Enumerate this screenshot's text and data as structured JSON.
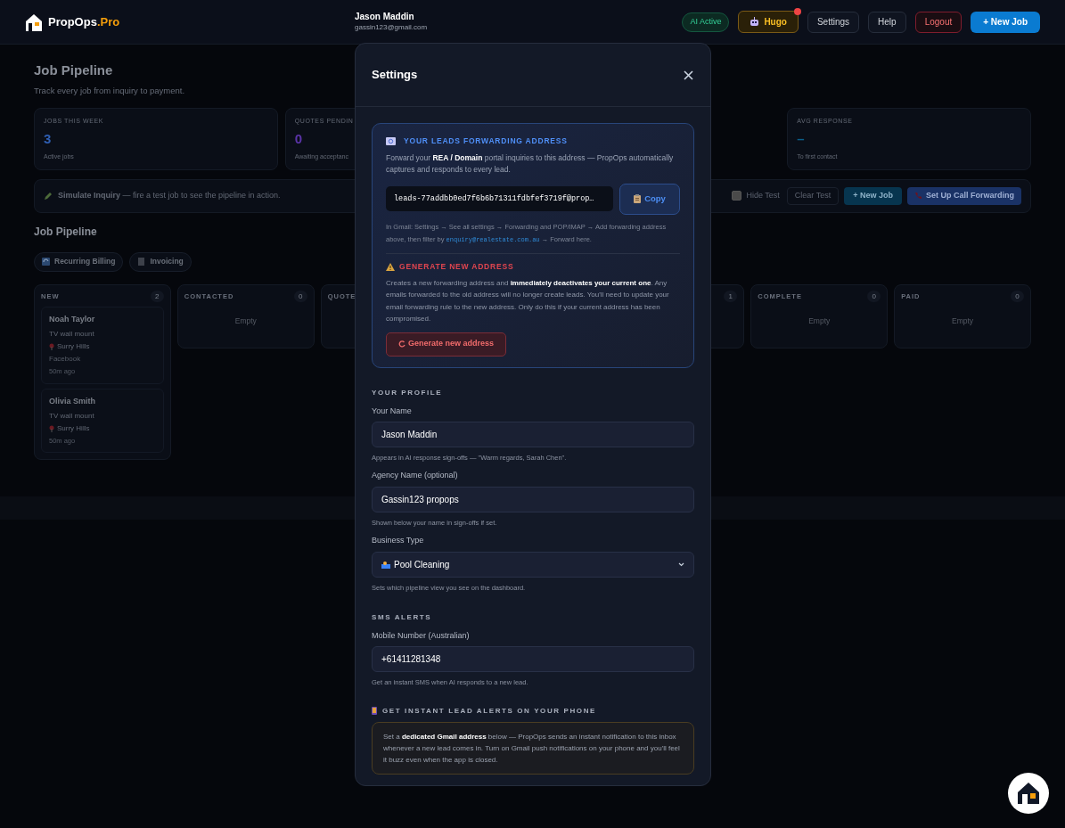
{
  "header": {
    "logo_text": "PropOps",
    "logo_suffix": ".Pro",
    "user_name": "Jason Maddin",
    "user_email": "gassin123@gmail.com",
    "status_badge": "AI Active",
    "assistant": {
      "label": "Hugo",
      "notification": true
    },
    "buttons": [
      {
        "label": "Settings",
        "kind": "plain"
      },
      {
        "label": "Help",
        "kind": "plain"
      },
      {
        "label": "Logout",
        "kind": "danger"
      },
      {
        "label": "+ New Job",
        "kind": "primary"
      }
    ]
  },
  "dashboard": {
    "title": "Job Pipeline",
    "subtitle": "Track every job from inquiry to payment.",
    "stats": [
      {
        "label": "JOBS THIS WEEK",
        "value": "3",
        "note": "Active jobs",
        "color": "#2f5fb3"
      },
      {
        "label": "QUOTES PENDIN",
        "value": "0",
        "note": "Awaiting acceptanc",
        "color": "#5b34a8"
      },
      {
        "label": "AVG RESPONSE",
        "value": "–",
        "note": "To first contact",
        "color": "#0b5f8a"
      }
    ],
    "toolbar": {
      "simulate": "**Simulate Inquiry** — fire a test job to see the pipeline in action.",
      "hide_test": {
        "label": "Hide Test",
        "checked": false
      },
      "buttons": [
        {
          "label": "Clear Test",
          "kind": "outline"
        },
        {
          "label": "+ New Job",
          "kind": "primary"
        },
        {
          "label": "Set Up Call Forwarding",
          "kind": "call"
        }
      ]
    },
    "pipeline_title": "Job Pipeline",
    "chips": [
      {
        "label": "Recurring Billing",
        "kind": "recurring"
      },
      {
        "label": "Invoicing",
        "kind": "invoice"
      }
    ],
    "columns": [
      {
        "title": "NEW",
        "count": "2",
        "cards": [
          {
            "name": "Noah Taylor",
            "service": "TV wall mount",
            "location": "Surry Hills",
            "source": "Facebook",
            "time": "50m ago"
          },
          {
            "name": "Olivia Smith",
            "service": "TV wall mount",
            "location": "Surry Hills",
            "time": "50m ago"
          }
        ]
      },
      {
        "title": "CONTACTED",
        "count": "0",
        "empty": "Empty"
      },
      {
        "title": "QUOTE"
      },
      {
        "count": "1"
      },
      {
        "title": "COMPLETE",
        "count": "0",
        "empty": "Empty"
      },
      {
        "title": "PAID",
        "count": "0",
        "empty": "Empty"
      }
    ]
  },
  "modal": {
    "title": "Settings",
    "leads": {
      "heading": "YOUR LEADS FORWARDING ADDRESS",
      "intro": "Forward your **REA / Domain** portal inquiries to this address — PropOps automatically captures and responds to every lead.",
      "address": "leads-77addbb0ed7f6b6b71311fdbfef3719f@prop…",
      "copy_label": "Copy",
      "help": "In Gmail: Settings → See all settings → Forwarding and POP/IMAP → Add forwarding address above, then filter by",
      "help_code": "enquiry@realestate.com.au",
      "help_end": "→ Forward here.",
      "warning_heading": "GENERATE NEW ADDRESS",
      "warning_text": "Creates a new forwarding address and **immediately deactivates your current one**. Any emails forwarded to the old address will no longer create leads. You'll need to update your email forwarding rule to the new address. Only do this if your current address has been compromised.",
      "generate_label": "Generate new address"
    },
    "sections": [
      {
        "title": "YOUR PROFILE",
        "fields": [
          {
            "label": "Your Name",
            "value": "Jason Maddin",
            "kind": "text",
            "hint": "Appears in AI response sign-offs — \"Warm regards, Sarah Chen\"."
          },
          {
            "label": "Agency Name (optional)",
            "value": "Gassin123 propops",
            "kind": "text",
            "hint": "Shown below your name in sign-offs if set."
          },
          {
            "label": "Business Type",
            "value": "Pool Cleaning",
            "kind": "select",
            "hint": "Sets which pipeline view you see on the dashboard."
          }
        ]
      },
      {
        "title": "SMS ALERTS",
        "fields": [
          {
            "label": "Mobile Number (Australian)",
            "value": "+61411281348",
            "kind": "text",
            "hint": "Get an instant SMS when AI responds to a new lead."
          }
        ]
      }
    ],
    "alerts": {
      "title": "GET INSTANT LEAD ALERTS ON YOUR PHONE",
      "text": "Set a **dedicated Gmail address** below — PropOps sends an instant notification to this inbox whenever a new lead comes in. Turn on Gmail push notifications on your phone and you'll feel it buzz even when the app is closed."
    }
  }
}
